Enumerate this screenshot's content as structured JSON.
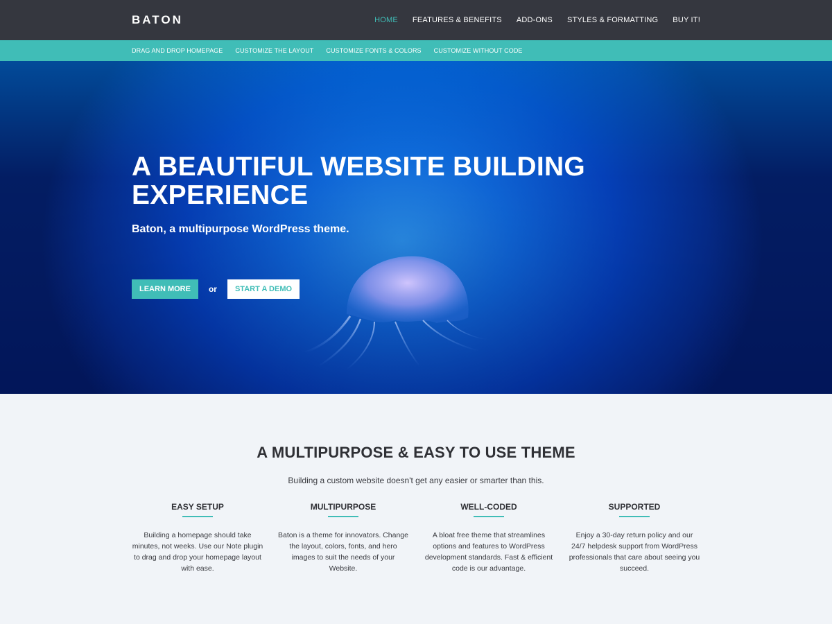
{
  "header": {
    "logo": "BATON",
    "nav": [
      {
        "label": "HOME",
        "active": true
      },
      {
        "label": "FEATURES & BENEFITS",
        "active": false
      },
      {
        "label": "ADD-ONS",
        "active": false
      },
      {
        "label": "STYLES & FORMATTING",
        "active": false
      },
      {
        "label": "BUY IT!",
        "active": false
      }
    ]
  },
  "subnav": [
    {
      "label": "DRAG AND DROP HOMEPAGE"
    },
    {
      "label": "CUSTOMIZE THE LAYOUT"
    },
    {
      "label": "CUSTOMIZE FONTS & COLORS"
    },
    {
      "label": "CUSTOMIZE WITHOUT CODE"
    }
  ],
  "hero": {
    "title": "A BEAUTIFUL WEBSITE BUILDING EXPERIENCE",
    "subtitle": "Baton, a multipurpose WordPress theme.",
    "primary_button": "LEARN MORE",
    "or_text": "or",
    "secondary_button": "START A DEMO"
  },
  "features": {
    "title": "A MULTIPURPOSE & EASY TO USE THEME",
    "lead": "Building a custom website  doesn't get any easier or smarter than this.",
    "items": [
      {
        "title": "EASY SETUP",
        "text": "Building a homepage should take minutes, not weeks. Use our Note plugin to drag and drop your homepage layout with ease."
      },
      {
        "title": "MULTIPURPOSE",
        "text": "Baton is a theme for innovators. Change the layout, colors, fonts, and hero images to suit the needs of your Website."
      },
      {
        "title": "WELL-CODED",
        "text": "A bloat free theme that streamlines options and features to WordPress development standards. Fast & efficient code is our advantage."
      },
      {
        "title": "SUPPORTED",
        "text": "Enjoy a 30-day return policy and our 24/7 helpdesk support from WordPress professionals that care about seeing you succeed."
      }
    ]
  },
  "colors": {
    "accent": "#40bdb7",
    "topbar": "#35373f",
    "page_bg": "#f1f4f8"
  }
}
